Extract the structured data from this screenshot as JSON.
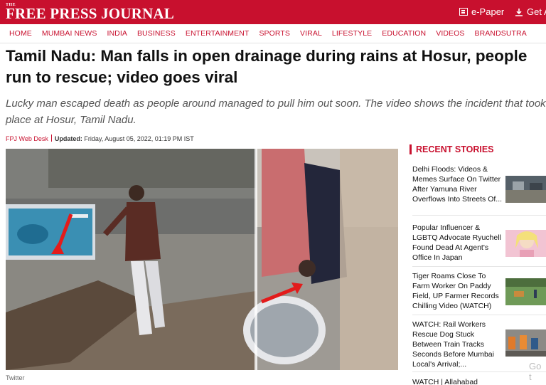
{
  "header": {
    "logo_the": "THE",
    "logo_name": "FREE PRESS JOURNAL",
    "epaper_label": "e-Paper",
    "getapp_label": "Get A"
  },
  "nav": {
    "items": [
      "HOME",
      "MUMBAI NEWS",
      "INDIA",
      "BUSINESS",
      "ENTERTAINMENT",
      "SPORTS",
      "VIRAL",
      "LIFESTYLE",
      "EDUCATION",
      "VIDEOS",
      "BRANDSUTRA"
    ]
  },
  "article": {
    "headline": "Tamil Nadu: Man falls in open drainage during rains at Hosur, people run to rescue; video goes viral",
    "subheadline": "Lucky man escaped death as people around managed to pull him out soon. The video shows the incident that took place at Hosur, Tamil Nadu.",
    "author": "FPJ Web Desk",
    "updated_label": "Updated:",
    "updated_value": "Friday, August 05, 2022, 01:19 PM IST",
    "image_caption": "Twitter"
  },
  "recent": {
    "title": "RECENT STORIES",
    "stories": [
      {
        "title": "Delhi Floods: Videos & Memes Surface On Twitter After Yamuna River Overflows Into Streets Of..."
      },
      {
        "title": "Popular Influencer & LGBTQ Advocate Ryuchell Found Dead At Agent's Office In Japan"
      },
      {
        "title": "Tiger Roams Close To Farm Worker On Paddy Field, UP Farmer Records Chilling Video (WATCH)"
      },
      {
        "title": "WATCH: Rail Workers Rescue Dog Stuck Between Train Tracks Seconds Before Mumbai Local's Arrival;..."
      },
      {
        "title": "WATCH | Allahabad"
      }
    ]
  },
  "overlay": {
    "goto_text": "Go t"
  },
  "colors": {
    "brand_red": "#c8102e"
  },
  "icons": {
    "epaper": "newspaper-icon",
    "getapp": "download-icon"
  }
}
